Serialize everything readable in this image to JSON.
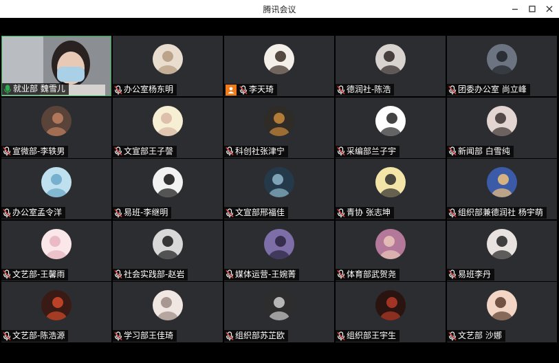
{
  "window": {
    "title": "腾讯会议",
    "controls": [
      "minimize",
      "maximize",
      "close"
    ]
  },
  "participants": [
    {
      "name": "就业部 魏雪儿",
      "video_on": true,
      "mic": "active",
      "colors": [
        "#c9c9cc",
        "#2b2b2b"
      ]
    },
    {
      "name": "办公室杨东明",
      "mic": "muted",
      "colors": [
        "#e9ddd0",
        "#b49a7e"
      ]
    },
    {
      "name": "李天琦",
      "mic": "muted",
      "host": true,
      "colors": [
        "#f4efe8",
        "#3a2b22"
      ]
    },
    {
      "name": "德润社-陈浩",
      "mic": "muted",
      "colors": [
        "#d8d3cf",
        "#2d2422"
      ]
    },
    {
      "name": "团委办公室 尚立峰",
      "mic": "muted",
      "colors": [
        "#6b7480",
        "#1f2328"
      ]
    },
    {
      "name": "宣微部-李轶男",
      "mic": "muted",
      "colors": [
        "#5a4338",
        "#c08060"
      ]
    },
    {
      "name": "文宣部王子謦",
      "mic": "muted",
      "colors": [
        "#f6efd4",
        "#d9b6a3"
      ]
    },
    {
      "name": "科创社张津宁",
      "mic": "muted",
      "colors": [
        "#2f2b26",
        "#c98a3c"
      ]
    },
    {
      "name": "采编部兰子宇",
      "mic": "muted",
      "colors": [
        "#ffffff",
        "#222222"
      ]
    },
    {
      "name": "新闻部 白雪纯",
      "mic": "muted",
      "colors": [
        "#e3d6d2",
        "#3a302e"
      ]
    },
    {
      "name": "办公室孟令洋",
      "mic": "muted",
      "colors": [
        "#bfe0ee",
        "#6aa6c8"
      ]
    },
    {
      "name": "易班-李继明",
      "mic": "muted",
      "colors": [
        "#f2f2f2",
        "#111111"
      ]
    },
    {
      "name": "文宣部邢福佳",
      "mic": "muted",
      "colors": [
        "#243a4a",
        "#8fb6c9"
      ]
    },
    {
      "name": "青协 张志坤",
      "mic": "muted",
      "colors": [
        "#f3e4a8",
        "#2a2a2a"
      ]
    },
    {
      "name": "组织部兼德润社 杨宇萌",
      "mic": "muted",
      "colors": [
        "#3b5aa8",
        "#f1c27a"
      ]
    },
    {
      "name": "文艺部-王馨雨",
      "mic": "muted",
      "colors": [
        "#fbe7ea",
        "#e6b3bd"
      ]
    },
    {
      "name": "社会实践部-赵岩",
      "mic": "muted",
      "colors": [
        "#d8d8d8",
        "#1a1a1a"
      ]
    },
    {
      "name": "媒体运营-王婉菁",
      "mic": "muted",
      "colors": [
        "#7d6ea8",
        "#2a233d"
      ]
    },
    {
      "name": "体育部武贺尧",
      "mic": "muted",
      "colors": [
        "#b4789a",
        "#e9c7b8"
      ]
    },
    {
      "name": "易班李丹",
      "mic": "muted",
      "colors": [
        "#e8e3e0",
        "#222222"
      ]
    },
    {
      "name": "文艺部-陈浩源",
      "mic": "muted",
      "colors": [
        "#3a1a14",
        "#d24a2a"
      ]
    },
    {
      "name": "学习部王佳琦",
      "mic": "muted",
      "colors": [
        "#f0e6e2",
        "#9b8a84"
      ]
    },
    {
      "name": "组织部苏芷欧",
      "mic": "muted",
      "colors": [
        "#2d2d2d",
        "#cfcfcf"
      ]
    },
    {
      "name": "组织部王宇生",
      "mic": "muted",
      "colors": [
        "#2a1410",
        "#b73a2a"
      ]
    },
    {
      "name": "文艺部 沙娜",
      "mic": "muted",
      "colors": [
        "#f2d5c5",
        "#5a3b2b"
      ]
    }
  ],
  "icons": {
    "muted_mic": "mic-muted-icon",
    "active_mic": "mic-active-icon",
    "host": "host-icon"
  },
  "colors": {
    "accent_green": "#2fa84f",
    "muted_red": "#e04545",
    "host_orange": "#f07b19"
  }
}
